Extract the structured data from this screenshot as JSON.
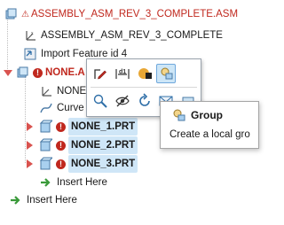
{
  "tree": {
    "root": {
      "label": "ASSEMBLY_ASM_REV_3_COMPLETE.ASM",
      "icon": "assembly-warning-icon"
    },
    "items": [
      {
        "label": "ASSEMBLY_ASM_REV_3_COMPLETE",
        "icon": "coordinate-system-icon"
      },
      {
        "label": "Import Feature id 4",
        "icon": "import-feature-icon"
      },
      {
        "label": "NONE.A",
        "icon": "subassembly-warning-icon"
      },
      {
        "label": "NONE",
        "icon": "coordinate-system-icon"
      },
      {
        "label": "Curve",
        "icon": "curve-icon"
      },
      {
        "label": "NONE_1.PRT",
        "icon": "part-icon"
      },
      {
        "label": "NONE_2.PRT",
        "icon": "part-icon"
      },
      {
        "label": "NONE_3.PRT",
        "icon": "part-icon"
      },
      {
        "label": "Insert Here",
        "icon": "insert-here-arrow-icon"
      },
      {
        "label": "Insert Here",
        "icon": "insert-here-arrow-icon"
      }
    ]
  },
  "mini_toolbar": {
    "buttons": [
      {
        "name": "edit-definition-icon"
      },
      {
        "name": "dimension-icon"
      },
      {
        "name": "appearance-icon"
      },
      {
        "name": "group-icon"
      },
      {
        "name": "zoom-to-selected-icon"
      },
      {
        "name": "hide-icon"
      },
      {
        "name": "regenerate-icon"
      },
      {
        "name": "mail-icon"
      },
      {
        "name": "more-icon"
      }
    ]
  },
  "tooltip": {
    "title": "Group",
    "description": "Create a local gro"
  },
  "colors": {
    "selection_highlight": "#cfe6f7",
    "warning_red": "#c0281e",
    "expander_red": "#d9534f",
    "insert_green": "#3a9a3a"
  }
}
